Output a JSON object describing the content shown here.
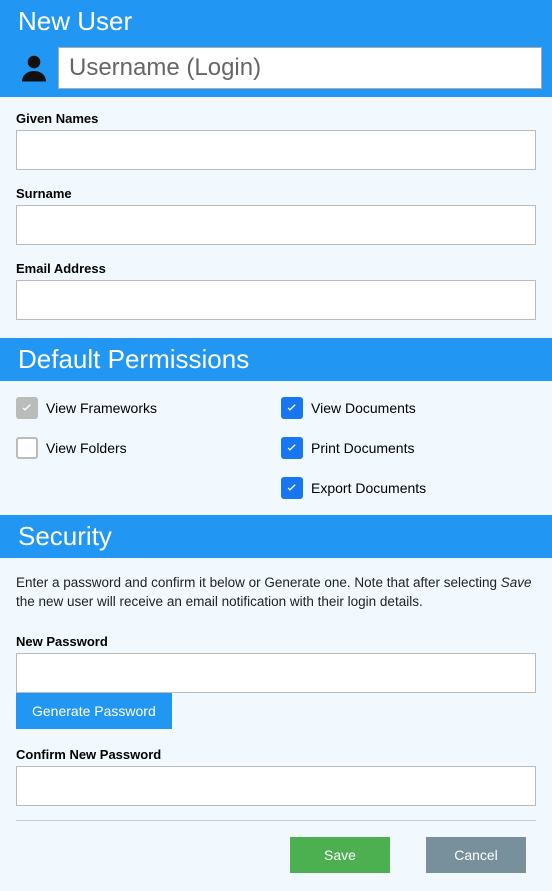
{
  "header": {
    "title": "New User"
  },
  "username": {
    "placeholder": "Username (Login)",
    "value": ""
  },
  "fields": {
    "given_names": {
      "label": "Given Names",
      "value": ""
    },
    "surname": {
      "label": "Surname",
      "value": ""
    },
    "email": {
      "label": "Email Address",
      "value": ""
    }
  },
  "permissions": {
    "title": "Default Permissions",
    "items": {
      "view_frameworks": {
        "label": "View Frameworks",
        "checked": true,
        "disabled": true
      },
      "view_folders": {
        "label": "View Folders",
        "checked": false,
        "disabled": false
      },
      "view_documents": {
        "label": "View Documents",
        "checked": true,
        "disabled": false
      },
      "print_documents": {
        "label": "Print Documents",
        "checked": true,
        "disabled": false
      },
      "export_documents": {
        "label": "Export Documents",
        "checked": true,
        "disabled": false
      }
    }
  },
  "security": {
    "title": "Security",
    "help_pre": "Enter a password and confirm it below or Generate one. Note that after selecting ",
    "help_em": "Save",
    "help_post": " the new user will receive an email notification with their login details.",
    "new_password": {
      "label": "New Password",
      "value": ""
    },
    "confirm_password": {
      "label": "Confirm New Password",
      "value": ""
    },
    "generate_label": "Generate Password"
  },
  "buttons": {
    "save": "Save",
    "cancel": "Cancel"
  }
}
